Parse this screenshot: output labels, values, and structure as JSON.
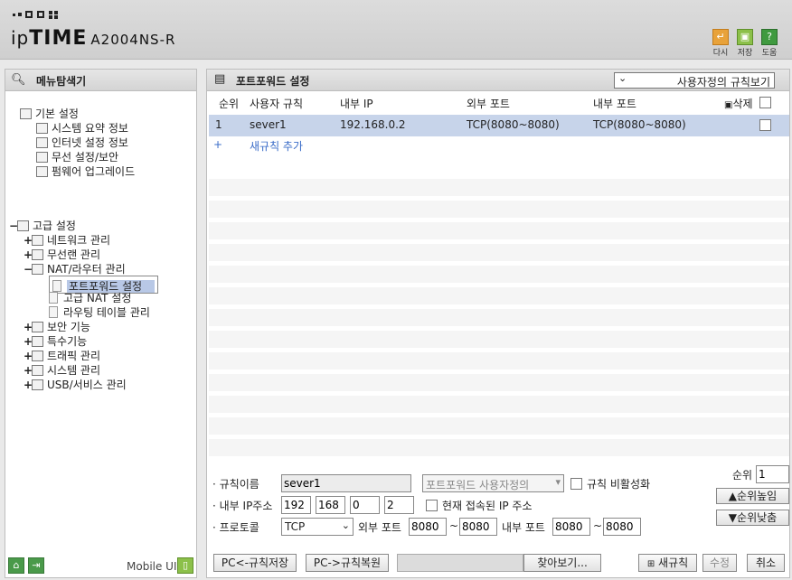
{
  "header": {
    "logo_ip": "ip",
    "logo_time": "TIME",
    "model": "A2004NS-R",
    "buttons": [
      {
        "label": "다시",
        "icon": "undo-icon",
        "color": "#e8a23a"
      },
      {
        "label": "저장",
        "icon": "save-icon",
        "color": "#8cc04a"
      },
      {
        "label": "도움",
        "icon": "help-icon",
        "color": "#3f9a3f"
      }
    ]
  },
  "sidebar": {
    "title": "메뉴탐색기",
    "basic": {
      "label": "기본 설정",
      "items": [
        "시스템 요약 정보",
        "인터넷 설정 정보",
        "무선 설정/보안",
        "펌웨어 업그레이드"
      ]
    },
    "advanced": {
      "label": "고급 설정",
      "network": "네트워크 관리",
      "wireless": "무선랜 관리",
      "nat": "NAT/라우터 관리",
      "nat_items": [
        "포트포워드 설정",
        "고급 NAT 설정",
        "라우팅 테이블 관리"
      ],
      "security": "보안 기능",
      "special": "특수기능",
      "traffic": "트래픽 관리",
      "system": "시스템 관리",
      "usb": "USB/서비스 관리"
    },
    "footer": {
      "mobile_label": "Mobile UI"
    }
  },
  "main": {
    "title": "포트포워드 설정",
    "view_select": "사용자정의 규칙보기",
    "columns": {
      "order": "순위",
      "rule": "사용자 규칙",
      "internal_ip": "내부 IP",
      "external_port": "외부 포트",
      "internal_port": "내부 포트",
      "delete": "삭제"
    },
    "rows": [
      {
        "order": "1",
        "rule": "sever1",
        "internal_ip": "192.168.0.2",
        "external_port": "TCP(8080~8080)",
        "internal_port": "TCP(8080~8080)"
      }
    ],
    "add_rule": "새규칙 추가",
    "add_icon": "+"
  },
  "form": {
    "rule_name_label": "규칙이름",
    "rule_name_value": "sever1",
    "preset_select": "포트포워드 사용자정의",
    "disable_label": "규칙 비활성화",
    "internal_ip_label": "내부 IP주소",
    "ip1": "192",
    "ip2": "168",
    "ip3": "0",
    "ip4": "2",
    "current_ip_label": "현재 접속된 IP 주소",
    "protocol_label": "프로토콜",
    "protocol_value": "TCP",
    "external_port_label": "외부 포트",
    "ext_from": "8080",
    "ext_to": "8080",
    "internal_port_label": "내부 포트",
    "int_from": "8080",
    "int_to": "8080",
    "tilde": "~",
    "order_label": "순위",
    "order_value": "1",
    "order_up": "▲순위높임",
    "order_down": "▼순위낮춤"
  },
  "bottom_buttons": {
    "pc_save": "PC<-규칙저장",
    "pc_restore": "PC->규칙복원",
    "browse": "찾아보기...",
    "new_rule": "새규칙",
    "modify": "수정",
    "cancel": "취소"
  }
}
